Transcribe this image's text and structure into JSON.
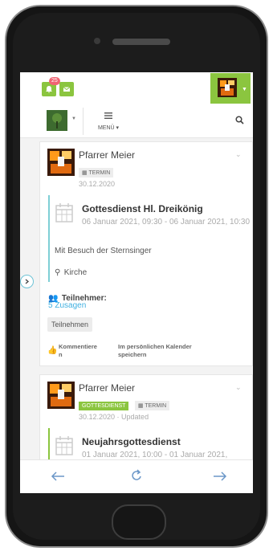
{
  "header": {
    "notification_count": "25"
  },
  "nav": {
    "menu_label": "MENÜ"
  },
  "posts": [
    {
      "author": "Pfarrer Meier",
      "tags": [
        "TERMIN"
      ],
      "date": "30.12.2020",
      "event_title": "Gottesdienst Hl. Dreikönig",
      "event_time": "06 Januar 2021, 09:30 - 06 Januar 2021, 10:30",
      "description": "Mit Besuch der Sternsinger",
      "location": "Kirche",
      "participants_label": "Teilnehmer:",
      "participants_value": "5 Zusagen",
      "join_button": "Teilnehmen",
      "comment_label": "Kommentiere n",
      "calendar_label": "Im persönlichen Kalender speichern"
    },
    {
      "author": "Pfarrer Meier",
      "tags": [
        "GOTTESDIENST",
        "TERMIN"
      ],
      "date": "30.12.2020 · Updated",
      "event_title": "Neujahrsgottesdienst",
      "event_time": "01 Januar 2021, 10:00 - 01 Januar 2021,"
    }
  ],
  "colors": {
    "brand_green": "#8bc53f",
    "link_blue": "#3fb0e0",
    "badge_red": "#f06473"
  }
}
